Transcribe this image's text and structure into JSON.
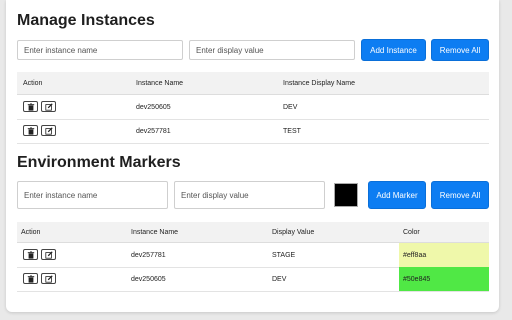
{
  "manage": {
    "title": "Manage Instances",
    "name_placeholder": "Enter instance name",
    "display_placeholder": "Enter display value",
    "add_label": "Add Instance",
    "remove_label": "Remove All",
    "headers": [
      "Action",
      "Instance Name",
      "Instance Display Name"
    ],
    "rows": [
      {
        "name": "dev250605",
        "display": "DEV"
      },
      {
        "name": "dev257781",
        "display": "TEST"
      }
    ]
  },
  "markers": {
    "title": "Environment Markers",
    "name_placeholder": "Enter instance name",
    "display_placeholder": "Enter display value",
    "swatch_color": "#000000",
    "add_label": "Add Marker",
    "remove_label": "Remove All",
    "headers": [
      "Action",
      "Instance Name",
      "Display Value",
      "Color"
    ],
    "rows": [
      {
        "name": "dev257781",
        "display": "STAGE",
        "color": "#eff8aa"
      },
      {
        "name": "dev250605",
        "display": "DEV",
        "color": "#50e845"
      }
    ]
  },
  "colors": {
    "accent": "#0d7df2"
  },
  "icons": {
    "delete": "trash-icon",
    "edit": "edit-icon"
  }
}
